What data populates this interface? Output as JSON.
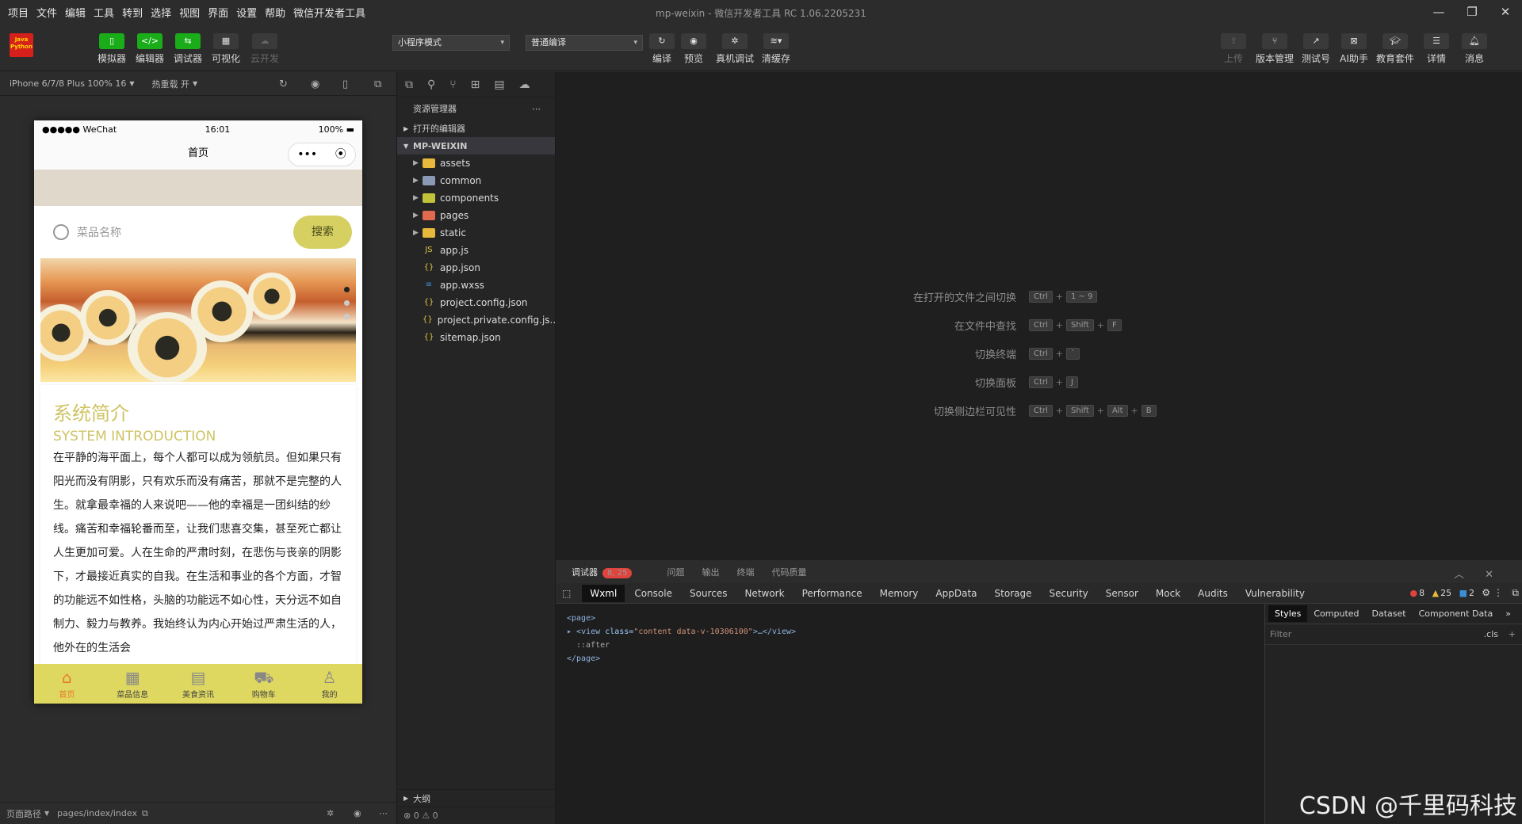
{
  "menubar": {
    "items": [
      "项目",
      "文件",
      "编辑",
      "工具",
      "转到",
      "选择",
      "视图",
      "界面",
      "设置",
      "帮助",
      "微信开发者工具"
    ],
    "window_title": "mp-weixin - 微信开发者工具 RC 1.06.2205231"
  },
  "toolbar": {
    "logo": "Java Python",
    "left_buttons": [
      {
        "label": "模拟器",
        "icon": "phone-icon"
      },
      {
        "label": "编辑器",
        "icon": "code-icon"
      },
      {
        "label": "调试器",
        "icon": "debug-icon"
      },
      {
        "label": "可视化",
        "icon": "layout-icon"
      },
      {
        "label": "云开发",
        "icon": "cloud-icon"
      }
    ],
    "mode_select": "小程序模式",
    "compile_select": "普通编译",
    "mid_buttons": [
      {
        "label": "编译",
        "icon": "refresh-icon"
      },
      {
        "label": "预览",
        "icon": "eye-icon"
      },
      {
        "label": "真机调试",
        "icon": "bug-icon"
      },
      {
        "label": "清缓存",
        "icon": "layers-icon"
      }
    ],
    "right_buttons": [
      {
        "label": "上传",
        "icon": "upload-icon"
      },
      {
        "label": "版本管理",
        "icon": "branch-icon"
      },
      {
        "label": "测试号",
        "icon": "external-icon"
      },
      {
        "label": "AI助手",
        "icon": "ai-icon"
      },
      {
        "label": "教育套件",
        "icon": "graduation-icon"
      },
      {
        "label": "详情",
        "icon": "menu-icon"
      },
      {
        "label": "消息",
        "icon": "bell-icon"
      }
    ]
  },
  "simulator": {
    "device": "iPhone 6/7/8 Plus 100% 16",
    "hotreload": "热重载 开",
    "status": {
      "carrier": "●●●●● WeChat",
      "time": "16:01",
      "battery": "100%"
    },
    "nav_title": "首页",
    "search_placeholder": "菜品名称",
    "search_button": "搜索",
    "intro_title": "系统简介",
    "intro_subtitle": "SYSTEM INTRODUCTION",
    "intro_body": "在平静的海平面上，每个人都可以成为领航员。但如果只有阳光而没有阴影，只有欢乐而没有痛苦，那就不是完整的人生。就拿最幸福的人来说吧——他的幸福是一团纠结的纱线。痛苦和幸福轮番而至，让我们悲喜交集，甚至死亡都让人生更加可爱。人在生命的严肃时刻，在悲伤与丧亲的阴影下，才最接近真实的自我。在生活和事业的各个方面，才智的功能远不如性格，头脑的功能远不如心性，天分远不如自制力、毅力与教养。我始终认为内心开始过严肃生活的人，他外在的生活会",
    "tabs": [
      {
        "label": "首页",
        "icon": "home-icon",
        "glyph": "⌂"
      },
      {
        "label": "菜品信息",
        "icon": "grid-icon",
        "glyph": "▦"
      },
      {
        "label": "美食资讯",
        "icon": "news-icon",
        "glyph": "▤"
      },
      {
        "label": "购物车",
        "icon": "cart-icon",
        "glyph": "⛟"
      },
      {
        "label": "我的",
        "icon": "user-icon",
        "glyph": "♙"
      }
    ],
    "bottom_path_label": "页面路径",
    "bottom_path": "pages/index/index"
  },
  "explorer": {
    "title": "资源管理器",
    "open_editors": "打开的编辑器",
    "project": "MP-WEIXIN",
    "folders": [
      {
        "name": "assets",
        "color": "#e8b93c"
      },
      {
        "name": "common",
        "color": "#8a9ab5"
      },
      {
        "name": "components",
        "color": "#c0c23a"
      },
      {
        "name": "pages",
        "color": "#e06a4e"
      },
      {
        "name": "static",
        "color": "#e8b93c"
      }
    ],
    "files": [
      {
        "name": "app.js",
        "glyph": "JS",
        "color": "#e0c341"
      },
      {
        "name": "app.json",
        "glyph": "{}",
        "color": "#e0c341"
      },
      {
        "name": "app.wxss",
        "glyph": "≡",
        "color": "#3b8fd6"
      },
      {
        "name": "project.config.json",
        "glyph": "{}",
        "color": "#e0c341"
      },
      {
        "name": "project.private.config.js...",
        "glyph": "{}",
        "color": "#e0c341"
      },
      {
        "name": "sitemap.json",
        "glyph": "{}",
        "color": "#e0c341"
      }
    ],
    "outline": "大纲",
    "problems": "⊗ 0 ⚠ 0"
  },
  "shortcuts": [
    {
      "label": "在打开的文件之间切换",
      "keys": [
        "Ctrl",
        "1 ~ 9"
      ]
    },
    {
      "label": "在文件中查找",
      "keys": [
        "Ctrl",
        "Shift",
        "F"
      ]
    },
    {
      "label": "切换终端",
      "keys": [
        "Ctrl",
        "`"
      ]
    },
    {
      "label": "切换面板",
      "keys": [
        "Ctrl",
        "J"
      ]
    },
    {
      "label": "切换侧边栏可见性",
      "keys": [
        "Ctrl",
        "Shift",
        "Alt",
        "B"
      ]
    }
  ],
  "debugger": {
    "top_tabs": [
      "调试器",
      "问题",
      "输出",
      "终端",
      "代码质量"
    ],
    "badge": "8, 25",
    "tabs": [
      "Wxml",
      "Console",
      "Sources",
      "Network",
      "Performance",
      "Memory",
      "AppData",
      "Storage",
      "Security",
      "Sensor",
      "Mock",
      "Audits",
      "Vulnerability"
    ],
    "errors": "8",
    "warnings": "25",
    "infos": "2",
    "dom_lines": {
      "l1": "<page>",
      "l2_tag": "<view",
      "l2_attr": "class=",
      "l2_val": "\"content data-v-10306100\"",
      "l2_end": ">…</view>",
      "l3": "::after",
      "l4": "</page>"
    },
    "styles_tabs": [
      "Styles",
      "Computed",
      "Dataset",
      "Component Data"
    ],
    "filter_placeholder": "Filter",
    "cls": ".cls"
  },
  "watermark": "CSDN @千里码科技"
}
